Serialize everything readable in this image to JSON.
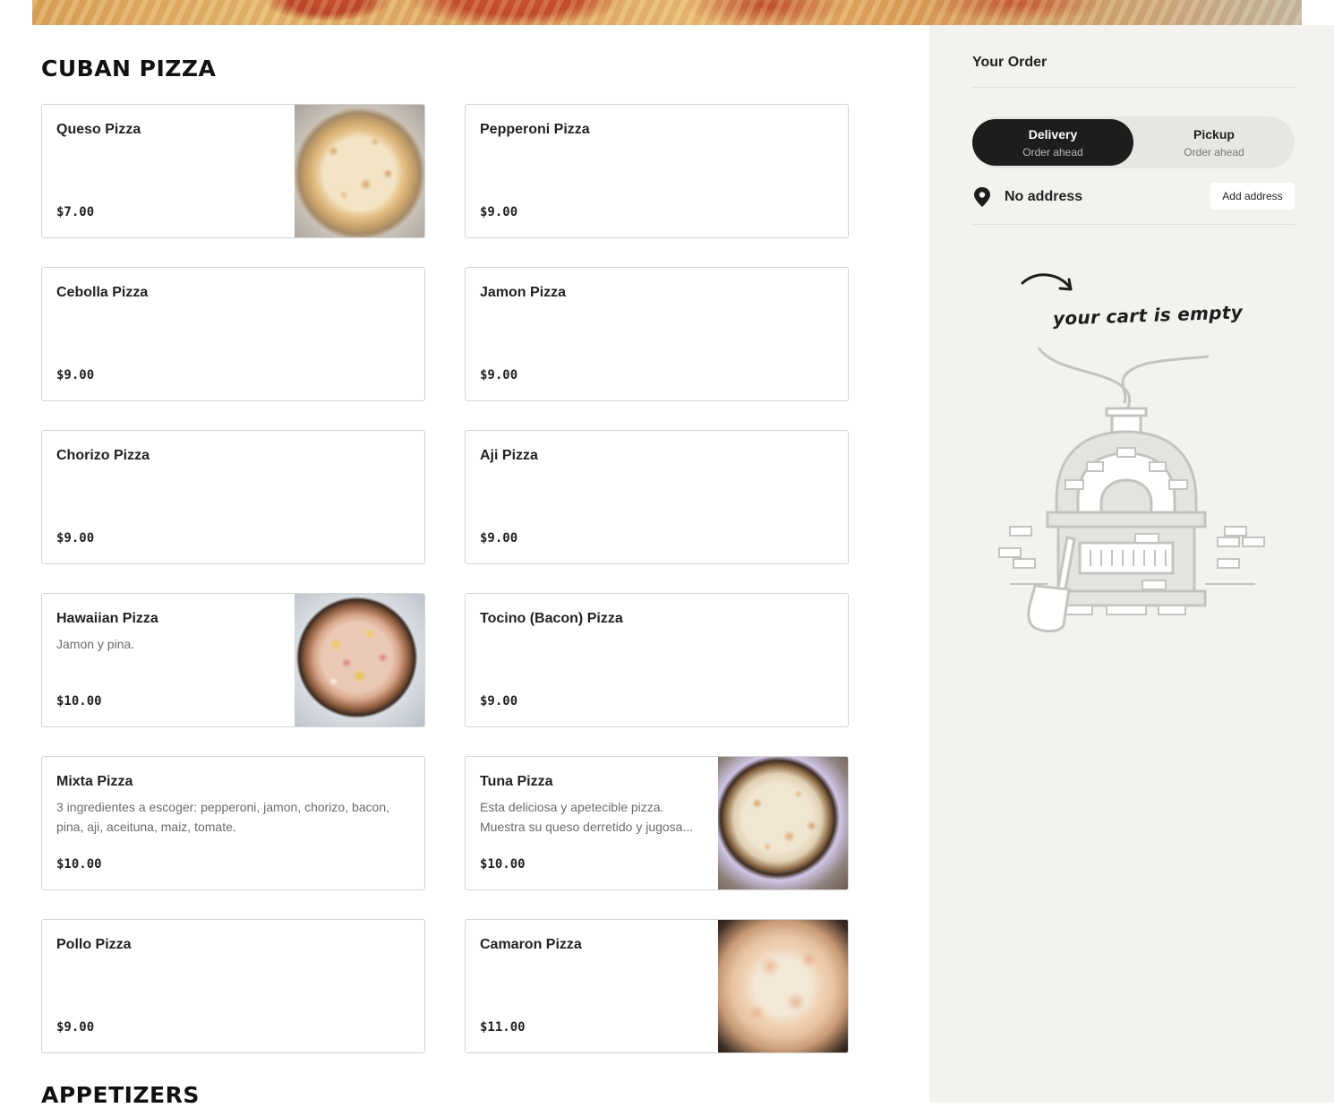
{
  "menu": {
    "section_title": "CUBAN PIZZA",
    "next_section_title": "APPETIZERS",
    "items": [
      {
        "name": "Queso Pizza",
        "description": "",
        "price": "$7.00",
        "image": "queso-pizza-photo"
      },
      {
        "name": "Pepperoni Pizza",
        "description": "",
        "price": "$9.00"
      },
      {
        "name": "Cebolla Pizza",
        "description": "",
        "price": "$9.00"
      },
      {
        "name": "Jamon Pizza",
        "description": "",
        "price": "$9.00"
      },
      {
        "name": "Chorizo Pizza",
        "description": "",
        "price": "$9.00"
      },
      {
        "name": "Aji Pizza",
        "description": "",
        "price": "$9.00"
      },
      {
        "name": "Hawaiian Pizza",
        "description": "Jamon y pina.",
        "price": "$10.00",
        "image": "hawaiian-pizza-photo"
      },
      {
        "name": "Tocino (Bacon) Pizza",
        "description": "",
        "price": "$9.00"
      },
      {
        "name": "Mixta Pizza",
        "description": "3 ingredientes a escoger: pepperoni, jamon, chorizo, bacon, pina, aji, aceituna, maiz, tomate.",
        "price": "$10.00"
      },
      {
        "name": "Tuna Pizza",
        "description": "Esta deliciosa y apetecible pizza. Muestra su queso derretido y jugosa...",
        "price": "$10.00",
        "image": "tuna-pizza-photo"
      },
      {
        "name": "Pollo Pizza",
        "description": "",
        "price": "$9.00"
      },
      {
        "name": "Camaron Pizza",
        "description": "",
        "price": "$11.00",
        "image": "camaron-pizza-photo"
      }
    ]
  },
  "order": {
    "title": "Your Order",
    "delivery": {
      "label": "Delivery",
      "sub": "Order ahead",
      "active": true
    },
    "pickup": {
      "label": "Pickup",
      "sub": "Order ahead",
      "active": false
    },
    "address_text": "No address",
    "address_icon": "location-pin-icon",
    "add_address_label": "Add address",
    "empty_message": "your cart is empty",
    "empty_illustration": "pizza-oven-illustration"
  },
  "colors": {
    "toggle_active_bg": "#1d1d1d",
    "sidebar_bg": "#f3f2ef",
    "card_border": "#d3d3d3"
  }
}
